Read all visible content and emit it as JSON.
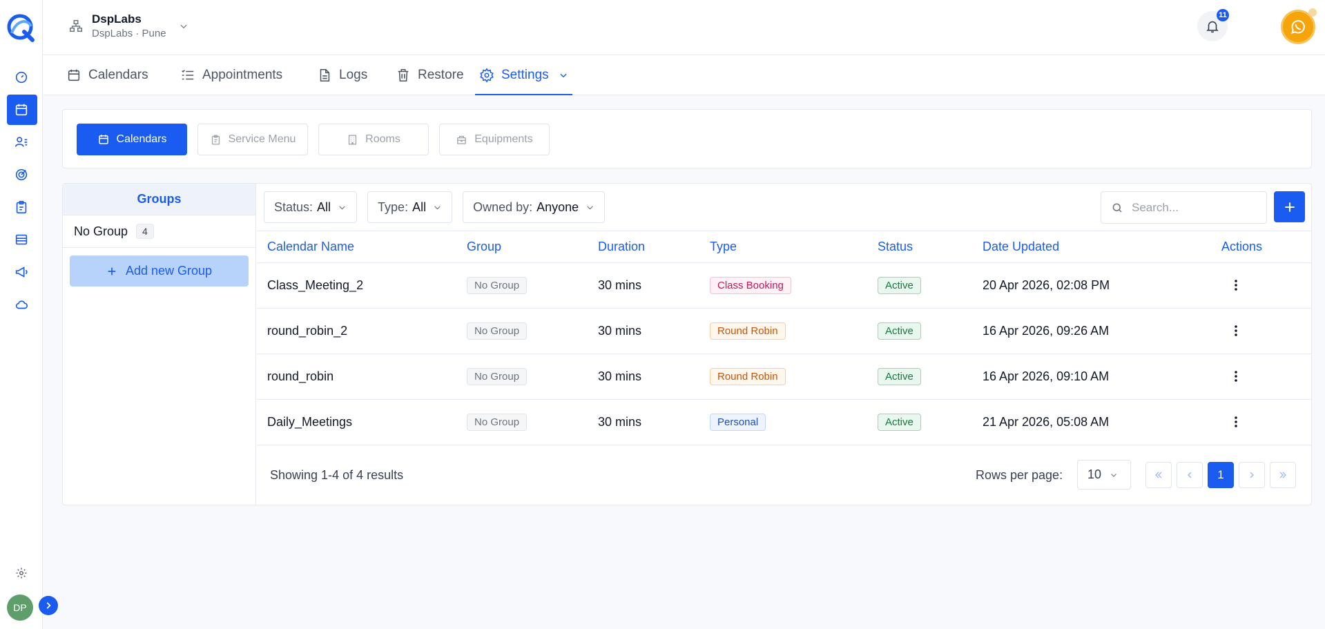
{
  "app": {
    "workspace_name": "DspLabs",
    "workspace_sub": "DspLabs · Pune",
    "notification_count": "11",
    "user_initials": "DP"
  },
  "tabs": [
    {
      "label": "Calendars",
      "icon": "calendar-icon"
    },
    {
      "label": "Appointments",
      "icon": "list-icon"
    },
    {
      "label": "Logs",
      "icon": "document-icon"
    },
    {
      "label": "Restore",
      "icon": "trash-icon"
    },
    {
      "label": "Settings",
      "icon": "gear-icon",
      "active": true
    }
  ],
  "subtabs": [
    {
      "label": "Calendars",
      "active": true
    },
    {
      "label": "Service Menu"
    },
    {
      "label": "Rooms"
    },
    {
      "label": "Equipments"
    }
  ],
  "groups": {
    "header": "Groups",
    "items": [
      {
        "label": "No Group",
        "count": "4"
      }
    ],
    "add_label": "Add new Group"
  },
  "filters": {
    "status_label": "Status:",
    "status_value": "All",
    "type_label": "Type:",
    "type_value": "All",
    "owner_label": "Owned by:",
    "owner_value": "Anyone"
  },
  "search": {
    "placeholder": "Search..."
  },
  "table": {
    "columns": [
      "Calendar Name",
      "Group",
      "Duration",
      "Type",
      "Status",
      "Date Updated",
      "Actions"
    ],
    "rows": [
      {
        "name": "Class_Meeting_2",
        "group": "No Group",
        "duration": "30 mins",
        "type": "Class Booking",
        "status": "Active",
        "updated": "20 Apr 2026, 02:08 PM"
      },
      {
        "name": "round_robin_2",
        "group": "No Group",
        "duration": "30 mins",
        "type": "Round Robin",
        "status": "Active",
        "updated": "16 Apr 2026, 09:26 AM"
      },
      {
        "name": "round_robin",
        "group": "No Group",
        "duration": "30 mins",
        "type": "Round Robin",
        "status": "Active",
        "updated": "16 Apr 2026, 09:10 AM"
      },
      {
        "name": "Daily_Meetings",
        "group": "No Group",
        "duration": "30 mins",
        "type": "Personal",
        "status": "Active",
        "updated": "21 Apr 2026, 05:08 AM"
      }
    ]
  },
  "footer": {
    "showing": "Showing 1-4 of 4 results",
    "rows_per_page_label": "Rows per page:",
    "rows_per_page_value": "10",
    "current_page": "1"
  },
  "colors": {
    "accent": "#1b5cf0",
    "whatsapp": "#f5a40b",
    "avatar": "#5e9e6a"
  }
}
